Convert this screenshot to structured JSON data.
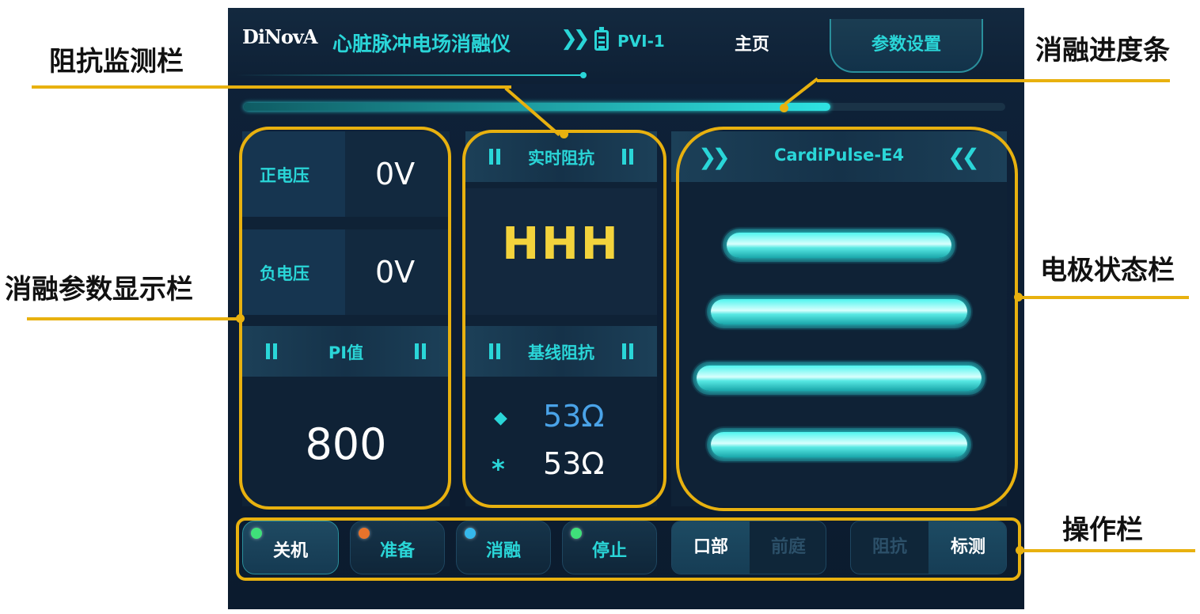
{
  "header": {
    "logo": "DiNovA",
    "device_title": "心脏脉冲电场消融仪",
    "device_id": "PVI-1",
    "nav_home": "主页",
    "nav_params": "参数设置"
  },
  "progress": {
    "value": 0.77
  },
  "ablation_params": {
    "positive_voltage_label": "正电压",
    "positive_voltage_value": "0V",
    "negative_voltage_label": "负电压",
    "negative_voltage_value": "0V",
    "pi_label": "PI值",
    "pi_value": "800"
  },
  "impedance": {
    "realtime_label": "实时阻抗",
    "realtime_value": "HHH",
    "baseline_label": "基线阻抗",
    "baseline_values": [
      {
        "symbol": "◆",
        "value": "53Ω",
        "color": "#4aa3e8"
      },
      {
        "symbol": "*",
        "value": "53Ω",
        "color": "#ffffff"
      }
    ]
  },
  "electrode_panel": {
    "catheter_name": "CardiPulse-E4",
    "electrodes": [
      "electrode-1",
      "electrode-2",
      "electrode-3",
      "electrode-4"
    ]
  },
  "operation_bar": {
    "buttons": [
      {
        "label": "关机",
        "led_color": "#3fe07a",
        "text_color": "#ffffff"
      },
      {
        "label": "准备",
        "led_color": "#e8732b",
        "text_color": "#2ad6d8"
      },
      {
        "label": "消融",
        "led_color": "#35b8ec",
        "text_color": "#2ad6d8"
      },
      {
        "label": "停止",
        "led_color": "#3fe07a",
        "text_color": "#2ad6d8"
      }
    ],
    "position_toggle": {
      "on": "口部",
      "off": "前庭"
    },
    "mode_toggle": {
      "off": "阻抗",
      "on": "标测"
    }
  },
  "annotations": {
    "impedance_bar": "阻抗监测栏",
    "progress_bar": "消融进度条",
    "param_bar": "消融参数显示栏",
    "electrode_bar": "电极状态栏",
    "operation_bar": "操作栏"
  },
  "colors": {
    "accent": "#2ad6d8",
    "annotation": "#e8b10f",
    "hhh": "#f3d33c"
  }
}
